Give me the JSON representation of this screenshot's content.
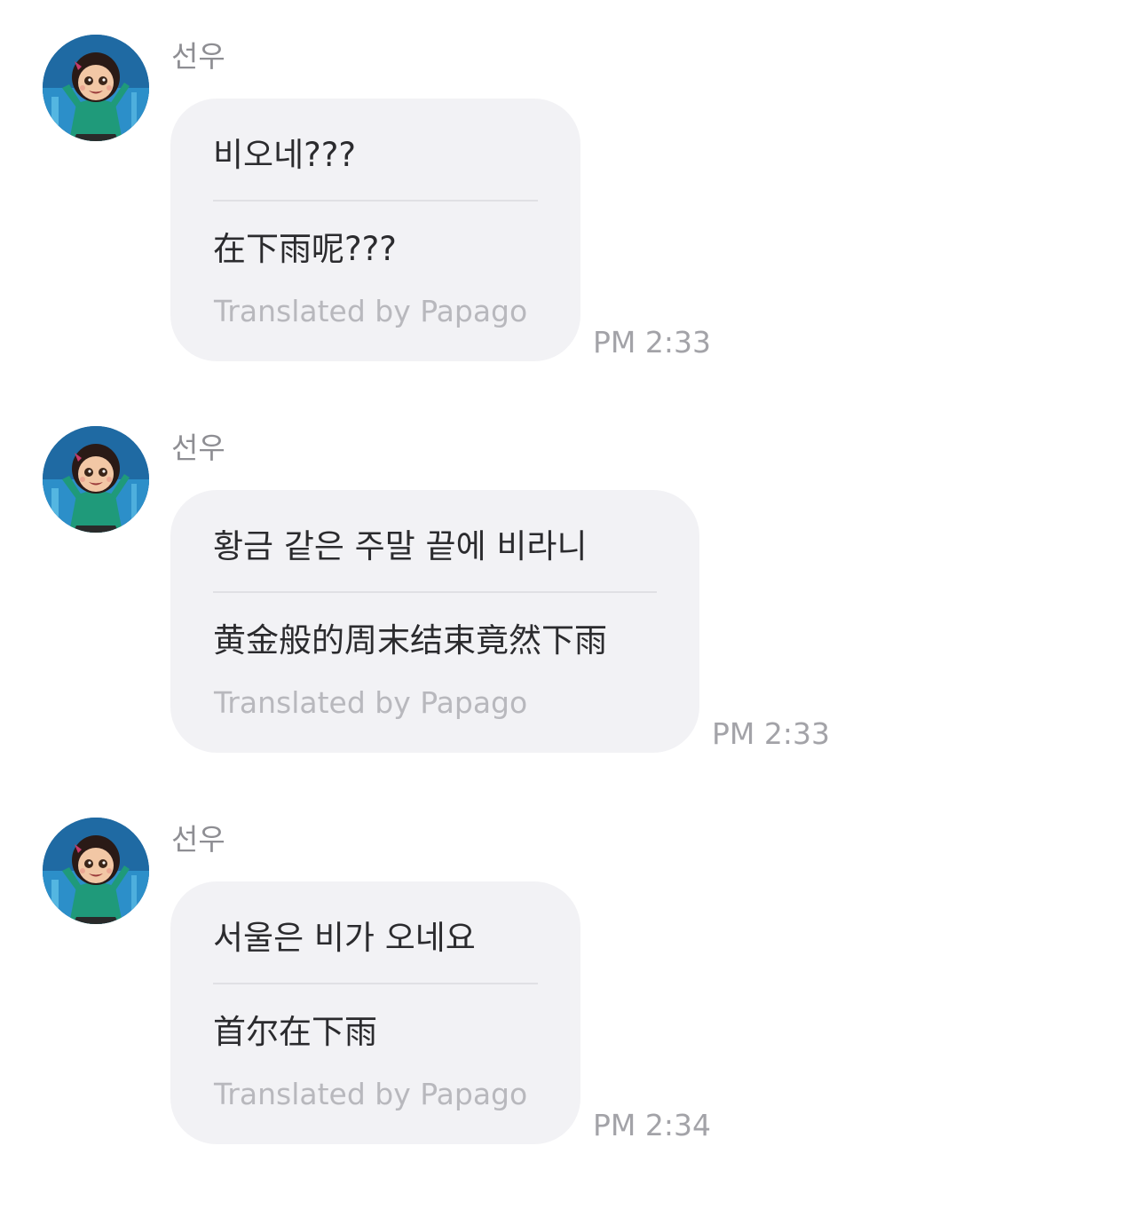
{
  "messages": [
    {
      "sender": "선우",
      "avatar": "avatar-girl-character",
      "original": "비오네???",
      "translation": "在下雨呢???",
      "credit": "Translated by Papago",
      "time": "PM 2:33"
    },
    {
      "sender": "선우",
      "avatar": "avatar-girl-character",
      "original": "황금 같은 주말 끝에 비라니",
      "translation": "黄金般的周末结束竟然下雨",
      "credit": "Translated by Papago",
      "time": "PM 2:33"
    },
    {
      "sender": "선우",
      "avatar": "avatar-girl-character",
      "original": "서울은 비가 오네요",
      "translation": "首尔在下雨",
      "credit": "Translated by Papago",
      "time": "PM 2:34"
    }
  ],
  "colors": {
    "bubble": "#f2f2f5",
    "text": "#2b2b2e",
    "muted": "#8e8e93",
    "credit": "#b8b8bd"
  }
}
